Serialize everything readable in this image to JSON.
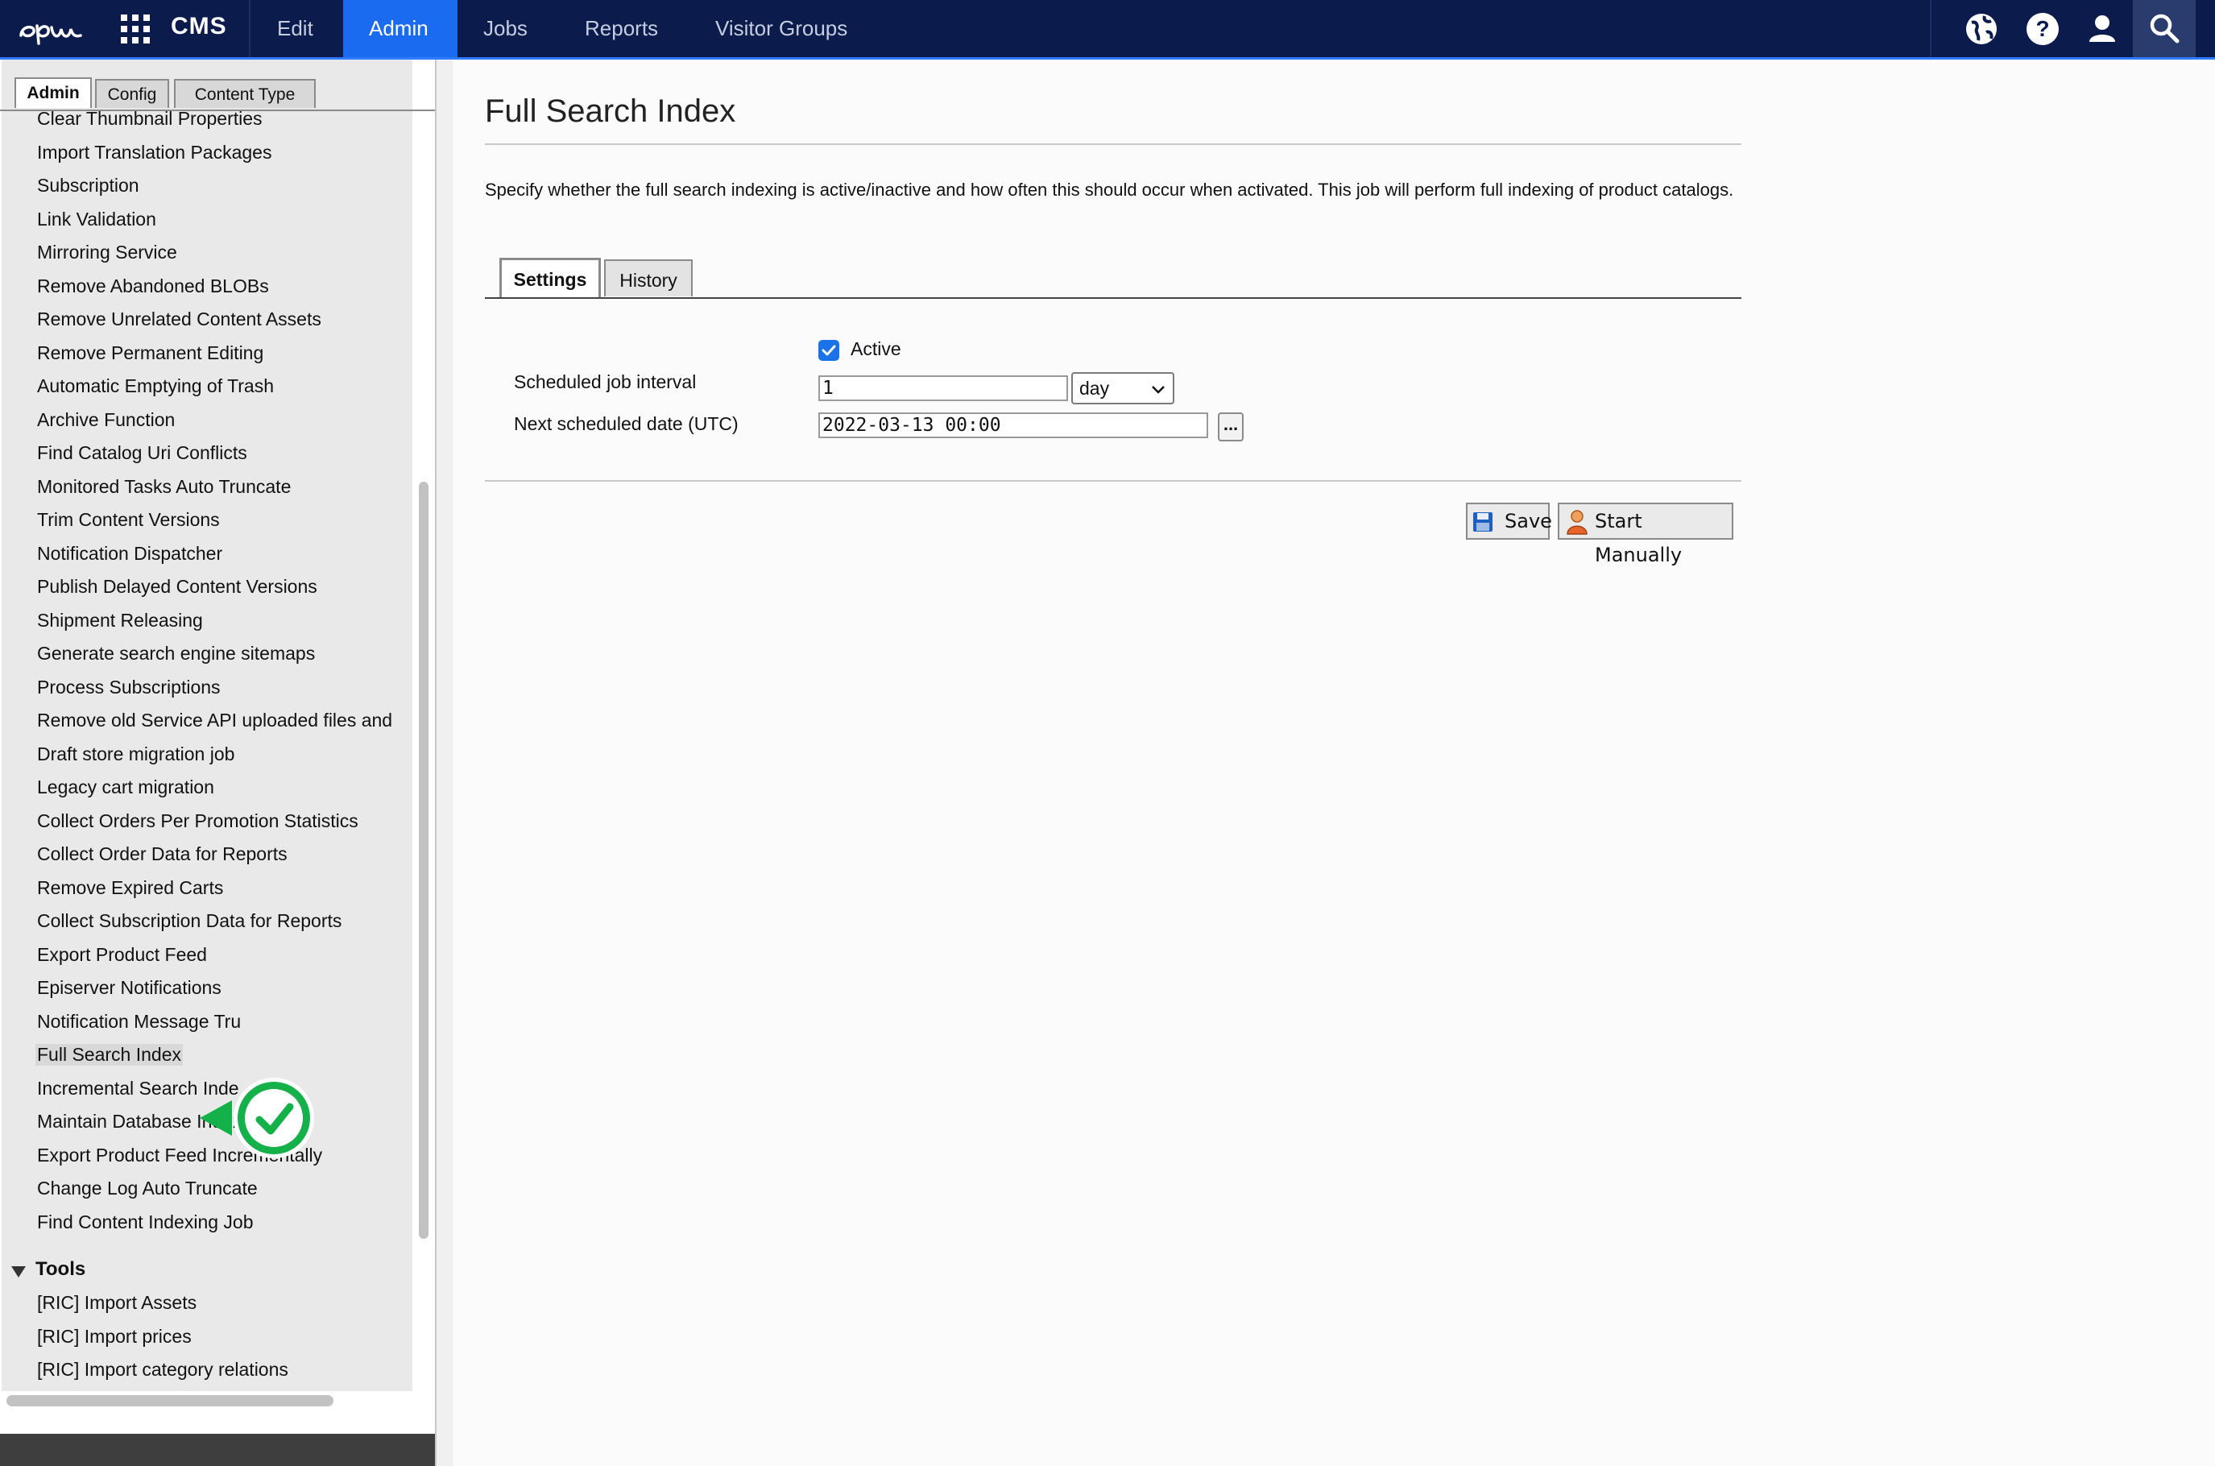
{
  "topbar": {
    "brand": "CMS",
    "nav": [
      "Edit",
      "Admin",
      "Jobs",
      "Reports",
      "Visitor Groups"
    ],
    "active_nav": "Admin",
    "icons": [
      "globe-icon",
      "help-icon",
      "user-icon",
      "search-icon"
    ]
  },
  "left_tabs": [
    "Admin",
    "Config",
    "Content Type"
  ],
  "job_list": [
    "Clear Thumbnail Properties",
    "Import Translation Packages",
    "Subscription",
    "Link Validation",
    "Mirroring Service",
    "Remove Abandoned BLOBs",
    "Remove Unrelated Content Assets",
    "Remove Permanent Editing",
    "Automatic Emptying of Trash",
    "Archive Function",
    "Find Catalog Uri Conflicts",
    "Monitored Tasks Auto Truncate",
    "Trim Content Versions",
    "Notification Dispatcher",
    "Publish Delayed Content Versions",
    "Shipment Releasing",
    "Generate search engine sitemaps",
    "Process Subscriptions",
    "Remove old Service API uploaded files and",
    "Draft store migration job",
    "Legacy cart migration",
    "Collect Orders Per Promotion Statistics",
    "Collect Order Data for Reports",
    "Remove Expired Carts",
    "Collect Subscription Data for Reports",
    "Export Product Feed",
    "Episerver Notifications",
    "Notification Message Tru",
    "Full Search Index",
    "Incremental Search Inde",
    "Maintain Database Indexes",
    "Export Product Feed Incrementally",
    "Change Log Auto Truncate",
    "Find Content Indexing Job"
  ],
  "tools_section": {
    "title": "Tools",
    "items": [
      "[RIC] Import Assets",
      "[RIC] Import prices",
      "[RIC] Import category relations"
    ]
  },
  "main": {
    "title": "Full Search Index",
    "description": "Specify whether the full search indexing is active/inactive and how often this should occur when activated. This job will perform full indexing of product catalogs.",
    "tabs": [
      "Settings",
      "History"
    ],
    "active_label": "Active",
    "interval_label": "Scheduled job interval",
    "interval_value": "1",
    "interval_unit": "day",
    "next_date_label": "Next scheduled date (UTC)",
    "next_date_value": "2022-03-13 00:00",
    "picker_label": "...",
    "save_label": "Save",
    "start_label": "Start Manually"
  },
  "colors": {
    "topbar": "#0b1b4b",
    "accent": "#1a6bf0",
    "badge_green": "#14b04a"
  }
}
